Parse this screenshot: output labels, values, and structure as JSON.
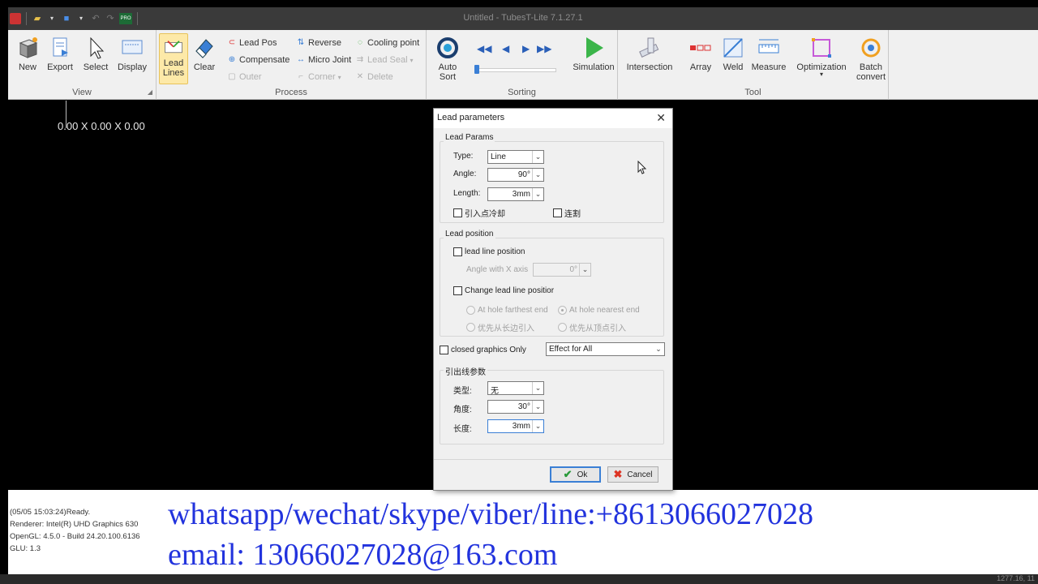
{
  "window": {
    "title": "Untitled - TubesT-Lite 7.1.27.1"
  },
  "qat": {
    "pro_label": "PRO"
  },
  "ribbon": {
    "view_group": "View",
    "process_group": "Process",
    "sorting_group": "Sorting",
    "tool_group": "Tool",
    "view_buttons": [
      "New",
      "Export",
      "Select",
      "Display"
    ],
    "lead_lines": [
      "Lead",
      "Lines"
    ],
    "clear": "Clear",
    "lead_pos": "Lead Pos",
    "compensate": "Compensate",
    "outer": "Outer",
    "reverse": "Reverse",
    "micro_joint": "Micro Joint",
    "corner": "Corner",
    "cooling_point": "Cooling point",
    "lead_seal": "Lead Seal",
    "delete": "Delete",
    "auto_sort": [
      "Auto",
      "Sort"
    ],
    "simulation": "Simulation",
    "tools": [
      "Intersection",
      "Array",
      "Weld",
      "Measure",
      "Optimization"
    ],
    "batch_convert": [
      "Batch",
      "convert"
    ]
  },
  "canvas": {
    "coords": "0.00 X 0.00 X 0.00"
  },
  "dialog": {
    "title": "Lead parameters",
    "lead_params": {
      "legend": "Lead Params",
      "type_label": "Type:",
      "type_value": "Line",
      "angle_label": "Angle:",
      "angle_value": "90°",
      "length_label": "Length:",
      "length_value": "3mm",
      "cool_label": "引入点冷却",
      "cut_label": "连割"
    },
    "lead_position": {
      "legend": "Lead position",
      "line_position": "lead line position",
      "angle_x_label": "Angle with X axis",
      "angle_x_value": "0°",
      "change_position": "Change lead line positior",
      "farthest": "At hole farthest end",
      "nearest": "At hole nearest end",
      "long_edge": "优先从长边引入",
      "vertex": "优先从顶点引入"
    },
    "closed_only": "closed graphics Only",
    "effect_value": "Effect for All",
    "lead_out": {
      "legend": "引出线参数",
      "type_label": "类型:",
      "type_value": "无",
      "angle_label": "角度:",
      "angle_value": "30°",
      "length_label": "长度:",
      "length_value": "3mm"
    },
    "ok": "Ok",
    "cancel": "Cancel"
  },
  "status": {
    "log": [
      "(05/05 15:03:24)Ready.",
      "Renderer: Intel(R) UHD Graphics 630",
      "OpenGL: 4.5.0 - Build 24.20.100.6136",
      "GLU: 1.3"
    ]
  },
  "overlay": {
    "line1": "whatsapp/wechat/skype/viber/line:+8613066027028",
    "line2": "email: 13066027028@163.com"
  },
  "bottom": {
    "text": "1277.16, 11"
  }
}
